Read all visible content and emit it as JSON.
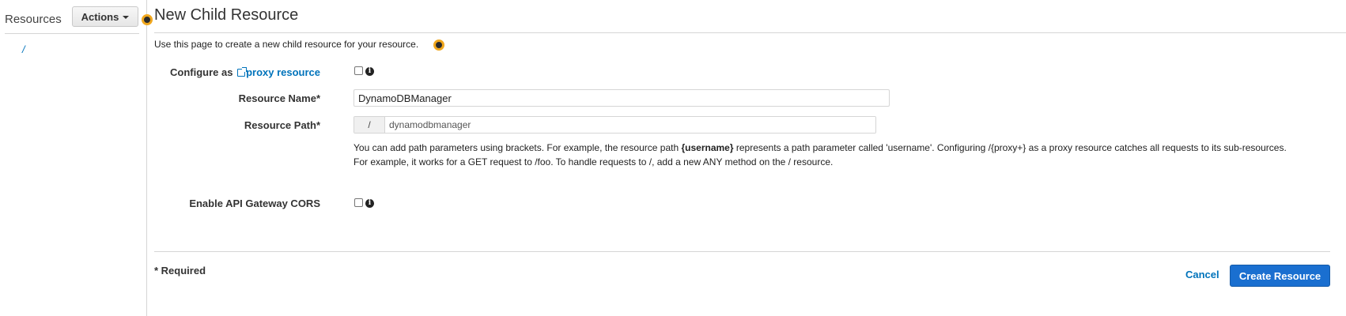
{
  "sidebar": {
    "title": "Resources",
    "actions_label": "Actions",
    "root_item": "/"
  },
  "main": {
    "title": "New Child Resource",
    "intro": "Use this page to create a new child resource for your resource."
  },
  "form": {
    "proxy": {
      "label_prefix": "Configure as ",
      "label_link": "proxy resource",
      "checked": false
    },
    "resource_name": {
      "label": "Resource Name*",
      "value": "DynamoDBManager"
    },
    "resource_path": {
      "label": "Resource Path*",
      "prefix": "/",
      "value": "dynamodbmanager"
    },
    "help": {
      "part1": "You can add path parameters using brackets. For example, the resource path ",
      "bold": "{username}",
      "part2": " represents a path parameter called 'username'. Configuring /{proxy+} as a proxy resource catches all requests to its sub-resources. For example, it works for a GET request to /foo. To handle requests to /, add a new ANY method on the / resource."
    },
    "cors": {
      "label": "Enable API Gateway CORS",
      "checked": false
    }
  },
  "footer": {
    "required_note": "* Required",
    "cancel_label": "Cancel",
    "create_label": "Create Resource"
  },
  "colors": {
    "link": "#0073bb",
    "primary_button": "#1a6fd0",
    "beacon": "#f0a71e"
  }
}
